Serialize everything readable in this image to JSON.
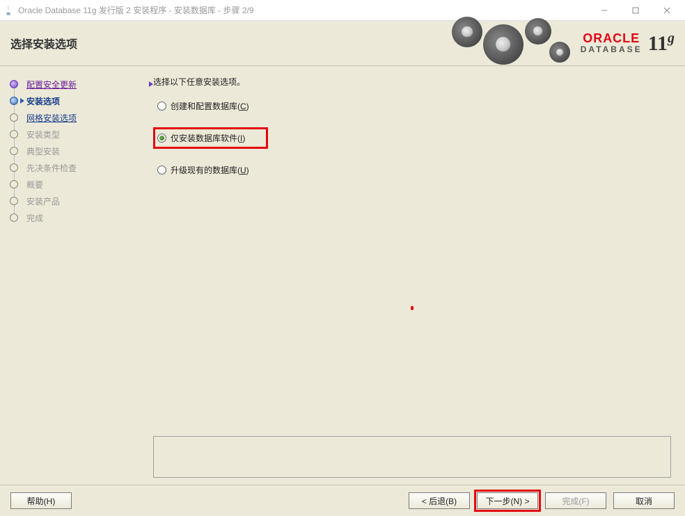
{
  "titlebar": {
    "title": "Oracle Database 11g 发行版 2 安装程序 - 安装数据库 - 步骤 2/9"
  },
  "header": {
    "heading": "选择安装选项",
    "logo_oracle": "ORACLE",
    "logo_database": "DATABASE",
    "logo_version": "11",
    "logo_version_sup": "g"
  },
  "sidebar": {
    "items": [
      {
        "label": "配置安全更新"
      },
      {
        "label": "安装选项"
      },
      {
        "label": "网格安装选项"
      },
      {
        "label": "安装类型"
      },
      {
        "label": "典型安装"
      },
      {
        "label": "先决条件检查"
      },
      {
        "label": "概要"
      },
      {
        "label": "安装产品"
      },
      {
        "label": "完成"
      }
    ]
  },
  "content": {
    "prompt": "选择以下任意安装选项。",
    "options": {
      "create": {
        "label": "创建和配置数据库(",
        "key": "C",
        "suffix": ")"
      },
      "install_only": {
        "label": "仅安装数据库软件(",
        "key": "I",
        "suffix": ")"
      },
      "upgrade": {
        "label": "升级现有的数据库(",
        "key": "U",
        "suffix": ")"
      }
    }
  },
  "footer": {
    "help": "帮助(H)",
    "back": "< 后退(B)",
    "next": "下一步(N) >",
    "finish": "完成(F)",
    "cancel": "取消"
  }
}
